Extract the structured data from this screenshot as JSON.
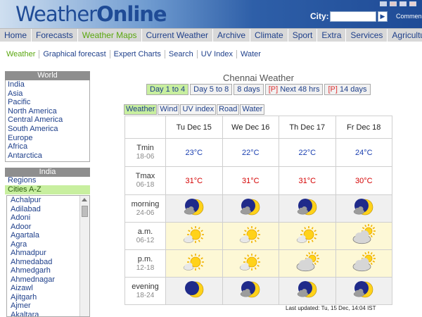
{
  "header": {
    "logo_part1": "Weather",
    "logo_part2": "Online",
    "city_label": "City:",
    "city_value": "",
    "commen_label": "Commen",
    "go_icon": "arrow-right-icon"
  },
  "mainnav": [
    "Home",
    "Forecasts",
    "Weather Maps",
    "Current Weather",
    "Archive",
    "Climate",
    "Sport",
    "Extra",
    "Services",
    "Agriculture"
  ],
  "mainnav_active": "Weather Maps",
  "subnav": [
    "Weather",
    "Graphical forecast",
    "Expert Charts",
    "Search",
    "UV Index",
    "Water"
  ],
  "world": {
    "heading": "World",
    "items": [
      "India",
      "Asia",
      "Pacific",
      "North America",
      "Central America",
      "South America",
      "Europe",
      "Africa",
      "Antarctica"
    ]
  },
  "india": {
    "heading": "India",
    "links": [
      "Regions",
      "Cities A-Z"
    ],
    "cities": [
      "Achalpur",
      "Adilabad",
      "Adoni",
      "Adoor",
      "Agartala",
      "Agra",
      "Ahmadpur",
      "Ahmedabad",
      "Ahmedgarh",
      "Ahmednagar",
      "Aizawl",
      "Ajitgarh",
      "Ajmer",
      "Akaltara"
    ]
  },
  "forecast": {
    "title": "Chennai Weather",
    "day_tabs": [
      {
        "prefix": "",
        "label": "Day 1 to 4"
      },
      {
        "prefix": "",
        "label": "Day 5 to 8"
      },
      {
        "prefix": "",
        "label": "8 days"
      },
      {
        "prefix": "[P]",
        "label": " Next 48 hrs"
      },
      {
        "prefix": "[P]",
        "label": " 14 days"
      }
    ],
    "type_tabs": [
      "Weather",
      "Wind",
      "UV index",
      "Road",
      "Water"
    ],
    "days": [
      "Tu Dec 15",
      "We Dec 16",
      "Th Dec 17",
      "Fr Dec 18"
    ],
    "tmin": {
      "label": "Tmin",
      "hours": "18-06",
      "values": [
        "23°C",
        "22°C",
        "22°C",
        "24°C"
      ]
    },
    "tmax": {
      "label": "Tmax",
      "hours": "06-18",
      "values": [
        "31°C",
        "31°C",
        "31°C",
        "30°C"
      ]
    },
    "periods": [
      {
        "label": "morning",
        "hours": "24-06",
        "kind": "night",
        "icons": [
          "moon-cloud-icon",
          "moon-cloud-icon",
          "moon-cloud-icon",
          "moon-cloud-icon"
        ]
      },
      {
        "label": "a.m.",
        "hours": "06-12",
        "kind": "day",
        "icons": [
          "sun-icon",
          "sun-icon",
          "sun-icon",
          "sun-cloud-icon"
        ]
      },
      {
        "label": "p.m.",
        "hours": "12-18",
        "kind": "day",
        "icons": [
          "sun-icon",
          "sun-icon",
          "sun-cloud-icon",
          "sun-cloud-icon"
        ]
      },
      {
        "label": "evening",
        "hours": "18-24",
        "kind": "night",
        "icons": [
          "moon-icon",
          "moon-cloud-icon",
          "moon-cloud-icon",
          "moon-cloud-icon"
        ]
      }
    ],
    "last_updated": "Last updated: Tu, 15 Dec, 14:04 IST"
  },
  "colors": {
    "link": "#1e3f8a",
    "active_green": "#5aa70f",
    "tmin_blue": "#1a3fb0",
    "tmax_red": "#d40000"
  }
}
